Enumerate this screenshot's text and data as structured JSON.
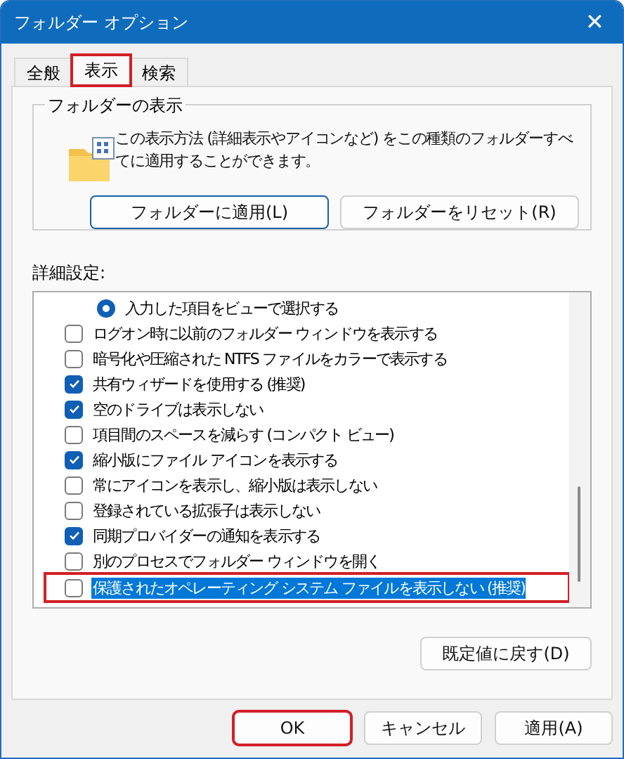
{
  "window": {
    "title": "フォルダー オプション",
    "close": "✕"
  },
  "tabs": [
    {
      "label": "全般",
      "selected": false,
      "highlighted": false
    },
    {
      "label": "表示",
      "selected": true,
      "highlighted": true
    },
    {
      "label": "検索",
      "selected": false,
      "highlighted": false
    }
  ],
  "folder_views": {
    "title": "フォルダーの表示",
    "description": "この表示方法 (詳細表示やアイコンなど) をこの種類のフォルダーすべてに適用することができます。",
    "buttons": [
      {
        "label": "フォルダーに適用(L)",
        "focused": true
      },
      {
        "label": "フォルダーをリセット(R)",
        "focused": false
      }
    ]
  },
  "advanced": {
    "label": "詳細設定:",
    "items": [
      {
        "kind": "radio",
        "label": "入力した項目をビューで選択する",
        "checked": true,
        "selected": false,
        "highlighted": false
      },
      {
        "kind": "checkbox",
        "label": "ログオン時に以前のフォルダー ウィンドウを表示する",
        "checked": false,
        "selected": false,
        "highlighted": false
      },
      {
        "kind": "checkbox",
        "label": "暗号化や圧縮された NTFS ファイルをカラーで表示する",
        "checked": false,
        "selected": false,
        "highlighted": false
      },
      {
        "kind": "checkbox",
        "label": "共有ウィザードを使用する (推奨)",
        "checked": true,
        "selected": false,
        "highlighted": false
      },
      {
        "kind": "checkbox",
        "label": "空のドライブは表示しない",
        "checked": true,
        "selected": false,
        "highlighted": false
      },
      {
        "kind": "checkbox",
        "label": "項目間のスペースを減らす (コンパクト ビュー)",
        "checked": false,
        "selected": false,
        "highlighted": false
      },
      {
        "kind": "checkbox",
        "label": "縮小版にファイル アイコンを表示する",
        "checked": true,
        "selected": false,
        "highlighted": false
      },
      {
        "kind": "checkbox",
        "label": "常にアイコンを表示し、縮小版は表示しない",
        "checked": false,
        "selected": false,
        "highlighted": false
      },
      {
        "kind": "checkbox",
        "label": "登録されている拡張子は表示しない",
        "checked": false,
        "selected": false,
        "highlighted": false
      },
      {
        "kind": "checkbox",
        "label": "同期プロバイダーの通知を表示する",
        "checked": true,
        "selected": false,
        "highlighted": false
      },
      {
        "kind": "checkbox",
        "label": "別のプロセスでフォルダー ウィンドウを開く",
        "checked": false,
        "selected": false,
        "highlighted": false
      },
      {
        "kind": "checkbox",
        "label": "保護されたオペレーティング システム ファイルを表示しない (推奨)",
        "checked": false,
        "selected": true,
        "highlighted": true
      }
    ],
    "restore_button": "既定値に戻す(D)"
  },
  "buttons": [
    {
      "label": "OK",
      "highlighted": true
    },
    {
      "label": "キャンセル",
      "highlighted": false
    },
    {
      "label": "適用(A)",
      "highlighted": false
    }
  ]
}
